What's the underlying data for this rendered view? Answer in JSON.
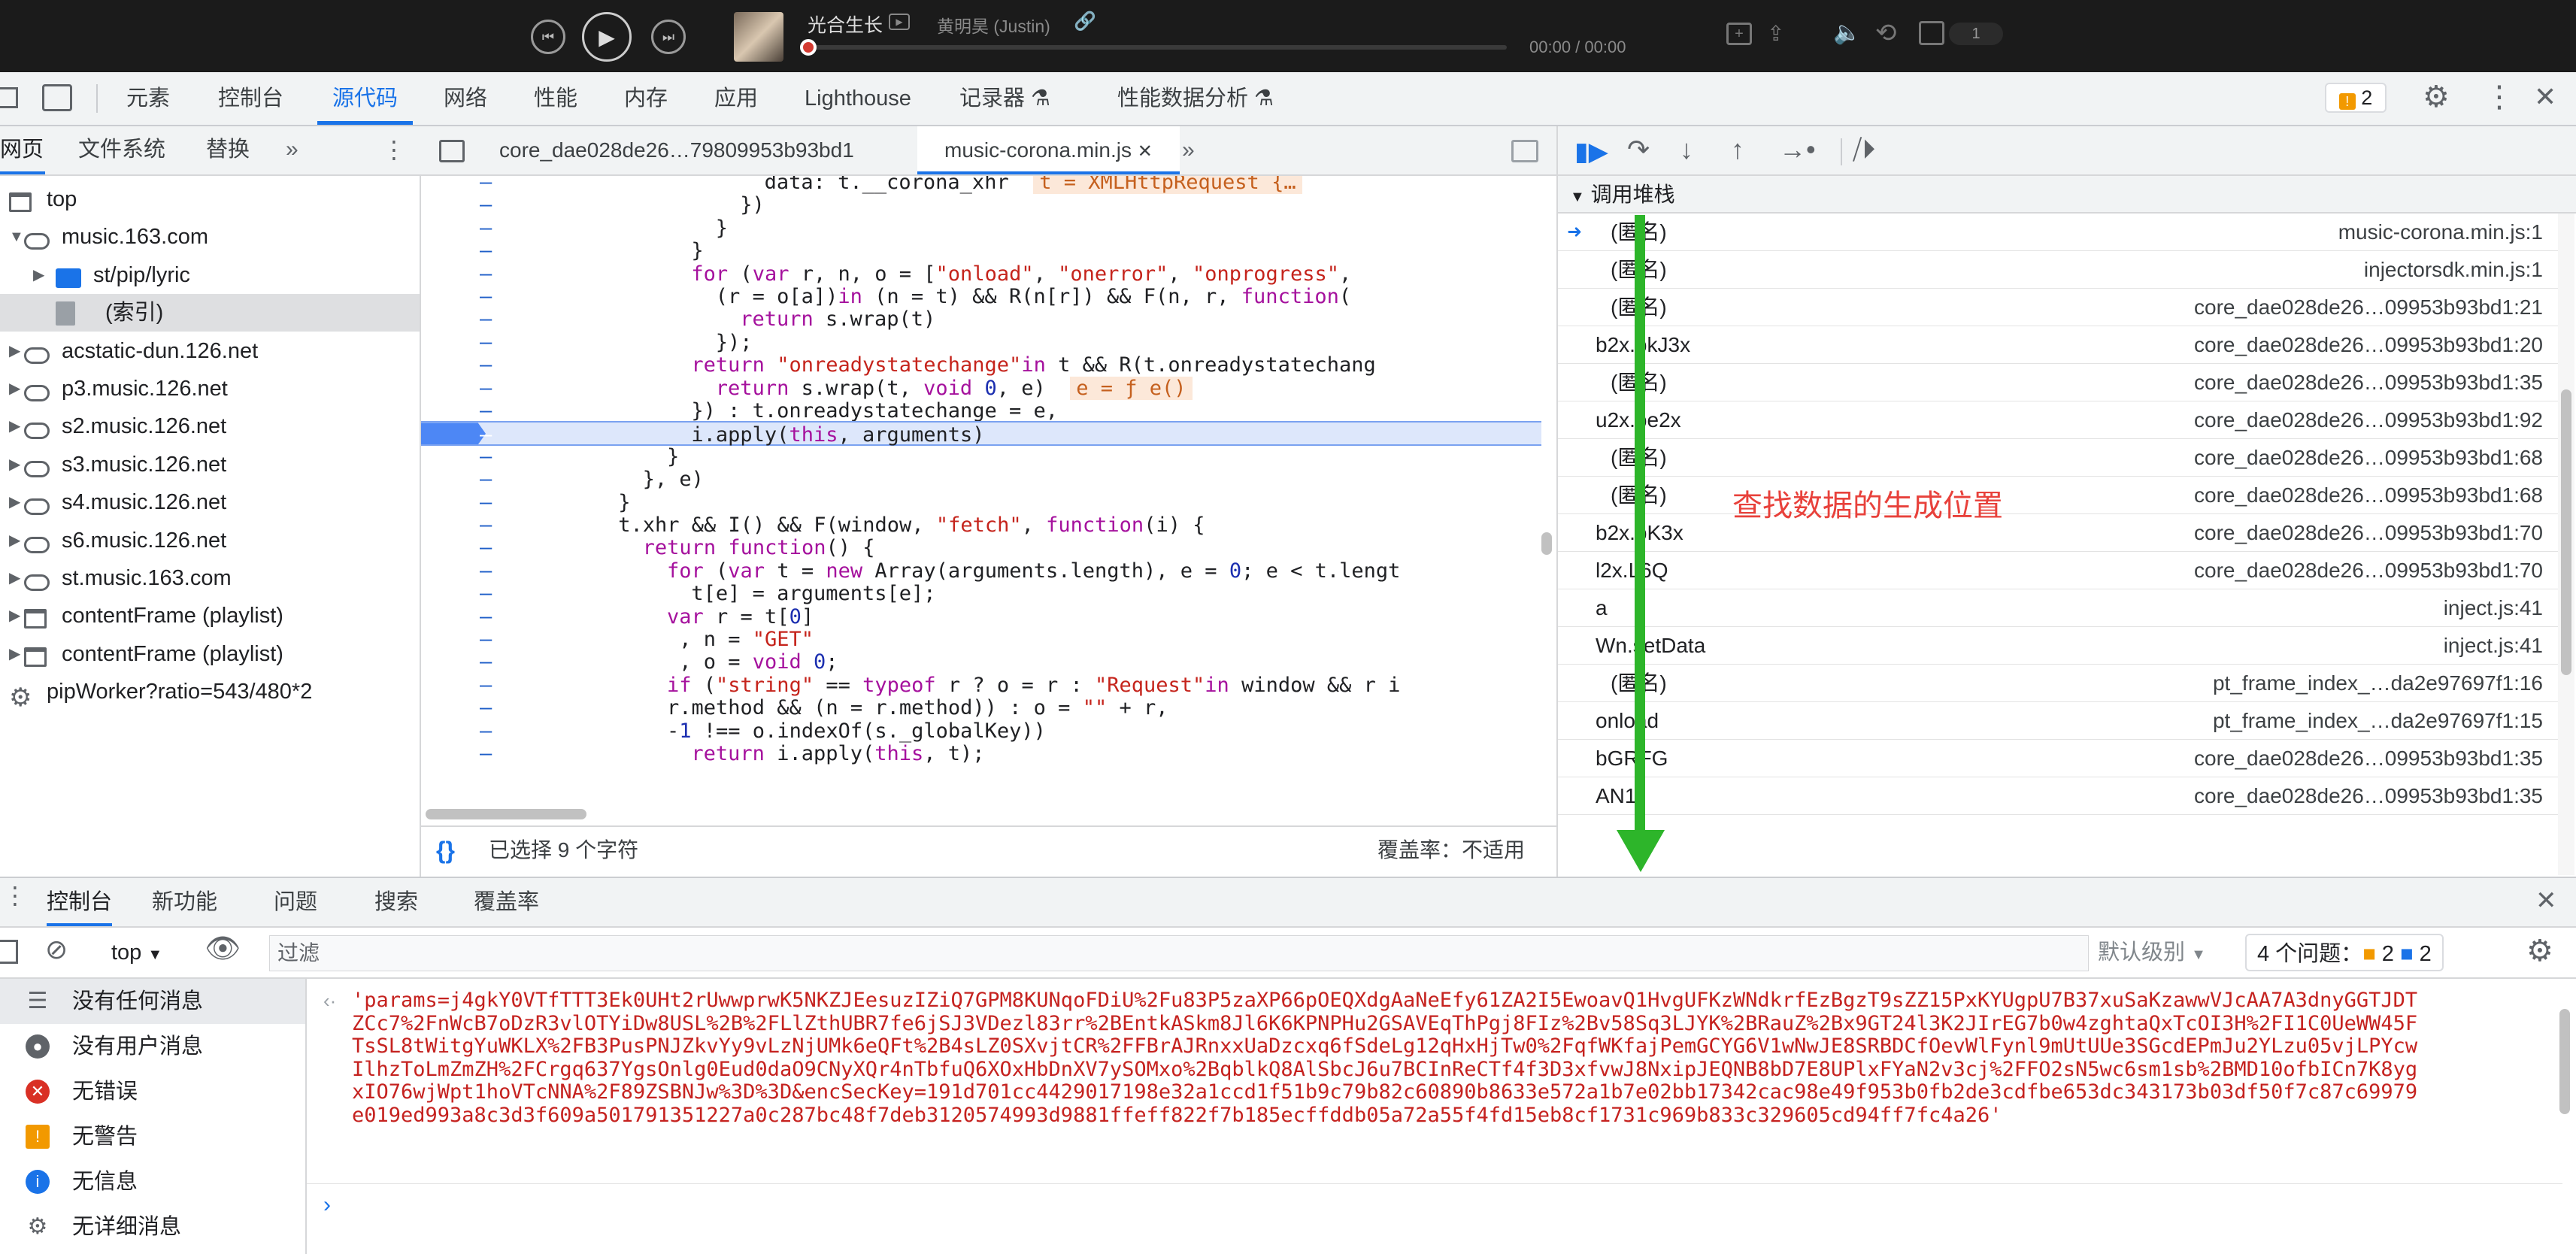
{
  "player": {
    "song_title": "光合生长",
    "artist": "黄明昊 (Justin)",
    "time": "00:00 / 00:00",
    "badge_count": "1"
  },
  "devtools": {
    "tabs": [
      "元素",
      "控制台",
      "源代码",
      "网络",
      "性能",
      "内存",
      "应用",
      "Lighthouse",
      "记录器 ⚗",
      "性能数据分析 ⚗"
    ],
    "active_tab": "源代码",
    "issue_count": "2"
  },
  "navigator": {
    "tabs": [
      "网页",
      "文件系统",
      "替换"
    ],
    "tree": [
      {
        "label": "top",
        "indent": 0,
        "icon": "frame",
        "arrow": ""
      },
      {
        "label": "music.163.com",
        "indent": 1,
        "icon": "cloud",
        "arrow": "▼"
      },
      {
        "label": "st/pip/lyric",
        "indent": 2,
        "icon": "folder",
        "arrow": "▶"
      },
      {
        "label": "(索引)",
        "indent": 3,
        "icon": "file",
        "arrow": ""
      },
      {
        "label": "acstatic-dun.126.net",
        "indent": 1,
        "icon": "cloud",
        "arrow": "▶"
      },
      {
        "label": "p3.music.126.net",
        "indent": 1,
        "icon": "cloud",
        "arrow": "▶"
      },
      {
        "label": "s2.music.126.net",
        "indent": 1,
        "icon": "cloud",
        "arrow": "▶"
      },
      {
        "label": "s3.music.126.net",
        "indent": 1,
        "icon": "cloud",
        "arrow": "▶"
      },
      {
        "label": "s4.music.126.net",
        "indent": 1,
        "icon": "cloud",
        "arrow": "▶"
      },
      {
        "label": "s6.music.126.net",
        "indent": 1,
        "icon": "cloud",
        "arrow": "▶"
      },
      {
        "label": "st.music.163.com",
        "indent": 1,
        "icon": "cloud",
        "arrow": "▶"
      },
      {
        "label": "contentFrame (playlist)",
        "indent": 1,
        "icon": "frame",
        "arrow": "▶"
      },
      {
        "label": "contentFrame (playlist)",
        "indent": 1,
        "icon": "frame",
        "arrow": "▶"
      },
      {
        "label": "pipWorker?ratio=543/480*2",
        "indent": 0,
        "icon": "gear",
        "arrow": ""
      }
    ]
  },
  "editor": {
    "tabs": [
      "core_dae028de26…79809953b93bd1",
      "music-corona.min.js"
    ],
    "status_selected": "已选择 9 个字符",
    "status_coverage": "覆盖率：不适用",
    "lines": [
      {
        "html": "                    data: t.__corona_xhr  <span class='ann'>t = XMLHttpRequest {…</span>",
        "hl": false
      },
      {
        "html": "                })",
        "hl": false
      },
      {
        "html": "            }",
        "hl": false
      },
      {
        "html": "        }",
        "hl": false
      },
      {
        "html": "        <span class='k'>for</span> (<span class='k'>var</span> r, n, o = [<span class='s'>\"onload\"</span>, <span class='s'>\"onerror\"</span>, <span class='s'>\"onprogress\"</span>,",
        "hl": false
      },
      {
        "html": "            (r = o[a])<span class='k'>in</span> (n = t) && R(n[r]) && F(n, r, <span class='k'>function</span>(",
        "hl": false
      },
      {
        "html": "                <span class='k'>return</span> s.wrap(t)",
        "hl": false
      },
      {
        "html": "            });",
        "hl": false
      },
      {
        "html": "        <span class='k'>return</span> <span class='s'>\"onreadystatechange\"</span><span class='k'>in</span> t && R(t.onreadystatechang",
        "hl": false
      },
      {
        "html": "            <span class='k'>return</span> s.wrap(t, <span class='k'>void</span> <span class='n'>0</span>, e)  <span class='ann'>e = ƒ e()</span>",
        "hl": false
      },
      {
        "html": "        }) : t.onreadystatechange = e,",
        "hl": false
      },
      {
        "html": "        i.apply(<span class='k'>this</span>, arguments)",
        "hl": true
      },
      {
        "html": "    }",
        "hl": false
      },
      {
        "html": "}, e)",
        "hl": false
      },
      {
        "html": "}",
        "hl": false
      },
      {
        "html": "t.xhr && I() && F(window, <span class='s'>\"fetch\"</span>, <span class='k'>function</span>(i) {",
        "hl": false
      },
      {
        "html": "    <span class='k'>return</span> <span class='k'>function</span>() {",
        "hl": false
      },
      {
        "html": "        <span class='k'>for</span> (<span class='k'>var</span> t = <span class='k'>new</span> Array(arguments.length), e = <span class='n'>0</span>; e < t.lengt",
        "hl": false
      },
      {
        "html": "            t[e] = arguments[e];",
        "hl": false
      },
      {
        "html": "        <span class='k'>var</span> r = t[<span class='n'>0</span>]",
        "hl": false
      },
      {
        "html": "          , n = <span class='s'>\"GET\"</span>",
        "hl": false
      },
      {
        "html": "          , o = <span class='k'>void</span> <span class='n'>0</span>;",
        "hl": false
      },
      {
        "html": "        <span class='k'>if</span> (<span class='s'>\"string\"</span> == <span class='k'>typeof</span> r ? o = r : <span class='s'>\"Request\"</span><span class='k'>in</span> window && r i",
        "hl": false
      },
      {
        "html": "        r.method && (n = r.method)) : o = <span class='s'>\"\"</span> + r,",
        "hl": false
      },
      {
        "html": "        -<span class='n'>1</span> !== o.indexOf(s._globalKey))",
        "hl": false
      },
      {
        "html": "            <span class='k'>return</span> i.apply(<span class='k'>this</span>, t);",
        "hl": false
      }
    ],
    "indents": [
      18,
      16,
      14,
      12,
      12,
      14,
      16,
      14,
      12,
      14,
      12,
      12,
      10,
      8,
      6,
      6,
      8,
      10,
      12,
      10,
      11,
      11,
      10,
      10,
      10,
      12
    ]
  },
  "callstack": {
    "title": "调用堆栈",
    "frames": [
      {
        "name": "(匿名)",
        "loc": "music-corona.min.js:1",
        "current": true
      },
      {
        "name": "(匿名)",
        "loc": "injectorsdk.min.js:1"
      },
      {
        "name": "(匿名)",
        "loc": "core_dae028de26…09953b93bd1:21"
      },
      {
        "name": "b2x.bkJ3x",
        "loc": "core_dae028de26…09953b93bd1:20"
      },
      {
        "name": "(匿名)",
        "loc": "core_dae028de26…09953b93bd1:35"
      },
      {
        "name": "u2x.be2x",
        "loc": "core_dae028de26…09953b93bd1:92"
      },
      {
        "name": "(匿名)",
        "loc": "core_dae028de26…09953b93bd1:68"
      },
      {
        "name": "(匿名)",
        "loc": "core_dae028de26…09953b93bd1:68"
      },
      {
        "name": "b2x.bK3x",
        "loc": "core_dae028de26…09953b93bd1:70"
      },
      {
        "name": "l2x.L6Q",
        "loc": "core_dae028de26…09953b93bd1:70"
      },
      {
        "name": "a",
        "loc": "inject.js:41"
      },
      {
        "name": "Wn.setData",
        "loc": "inject.js:41"
      },
      {
        "name": "(匿名)",
        "loc": "pt_frame_index_…da2e97697f1:16"
      },
      {
        "name": "onload",
        "loc": "pt_frame_index_…da2e97697f1:15"
      },
      {
        "name": "bGRFG",
        "loc": "core_dae028de26…09953b93bd1:35"
      },
      {
        "name": "AN1",
        "loc": "core_dae028de26…09953b93bd1:35"
      }
    ],
    "annotation": "查找数据的生成位置"
  },
  "drawer": {
    "tabs": [
      "控制台",
      "新功能",
      "问题",
      "搜索",
      "覆盖率"
    ],
    "context": "top",
    "filter_placeholder": "过滤",
    "levels": "默认级别",
    "issues_label": "4 个问题：",
    "issues_warn": "2",
    "issues_info": "2",
    "sidebar": [
      {
        "label": "没有任何消息",
        "icon": "list"
      },
      {
        "label": "没有用户消息",
        "icon": "user"
      },
      {
        "label": "无错误",
        "icon": "error"
      },
      {
        "label": "无警告",
        "icon": "warning"
      },
      {
        "label": "无信息",
        "icon": "info"
      },
      {
        "label": "无详细消息",
        "icon": "verbose"
      }
    ],
    "log": "'params=j4gkY0VTfTTT3Ek0UHt2rUwwprwK5NKZJEesuzIZiQ7GPM8KUNqoFDiU%2Fu83P5zaXP66pOEQXdgAaNeEfy61ZA2I5EwoavQ1HvgUFKzWNdkrfEzBgzT9sZZ15PxKYUgpU7B37xuSaKzawwVJcAA7A3dnyGGTJDTZCc7%2FnWcB7oDzR3vlOTYiDw8USL%2B%2FLlZthUBR7fe6jSJ3VDezl83rr%2BEntkASkm8Jl6K6KPNPHu2GSAVEqThPgj8FIz%2Bv58Sq3LJYK%2BRauZ%2Bx9GT24l3K2JIrEG7b0w4zghtaQxTcOI3H%2FI1C0UeWW45FTsSL8tWitgYuWKLX%2FB3PusPNJZkvYy9vLzNjUMk6eQFt%2B4sLZ0SXvjtCR%2FFBrAJRnxxUaDzcxq6fSdeLg12qHxHjTw0%2FqfWKfajPemGCYG6V1wNwJE8SRBDCfOevWlFynl9mUtUUe3SGcdEPmJu2YLzu05vjLPYcwIlhzToLmZmZH%2FCrgq637YgsOnlg0Eud0daO9CNyXQr4nTbfuQ6XOxHbDnXV7ySOMxo%2BqblkQ8AlSbcJ6u7BCInReCTf4f3D3xfvwJ8NxipJEQNB8bD7E8UPlxFYaN2v3cj%2FFO2sN5wc6sm1sb%2BMD10ofbICn7K8ygxIO76wjWpt1hoVTcNNA%2F89ZSBNJw%3D%3D&encSecKey=191d701cc4429017198e32a1ccd1f51b9c79b82c60890b8633e572a1b7e02bb17342cac98e49f953b0fb2de3cdfbe653dc343173b03df50f7c87c69979e019ed993a8c3d3f609a501791351227a0c287bc48f7deb3120574993d9881ffeff822f7b185ecffddb05a72a55f4fd15eb8cf1731c969b833c329605cd94ff7fc4a26'"
  },
  "colors": {
    "accent": "#1a73e8",
    "error": "#c5221f",
    "arrow": "#2db52a",
    "annotation": "#e8413b"
  }
}
